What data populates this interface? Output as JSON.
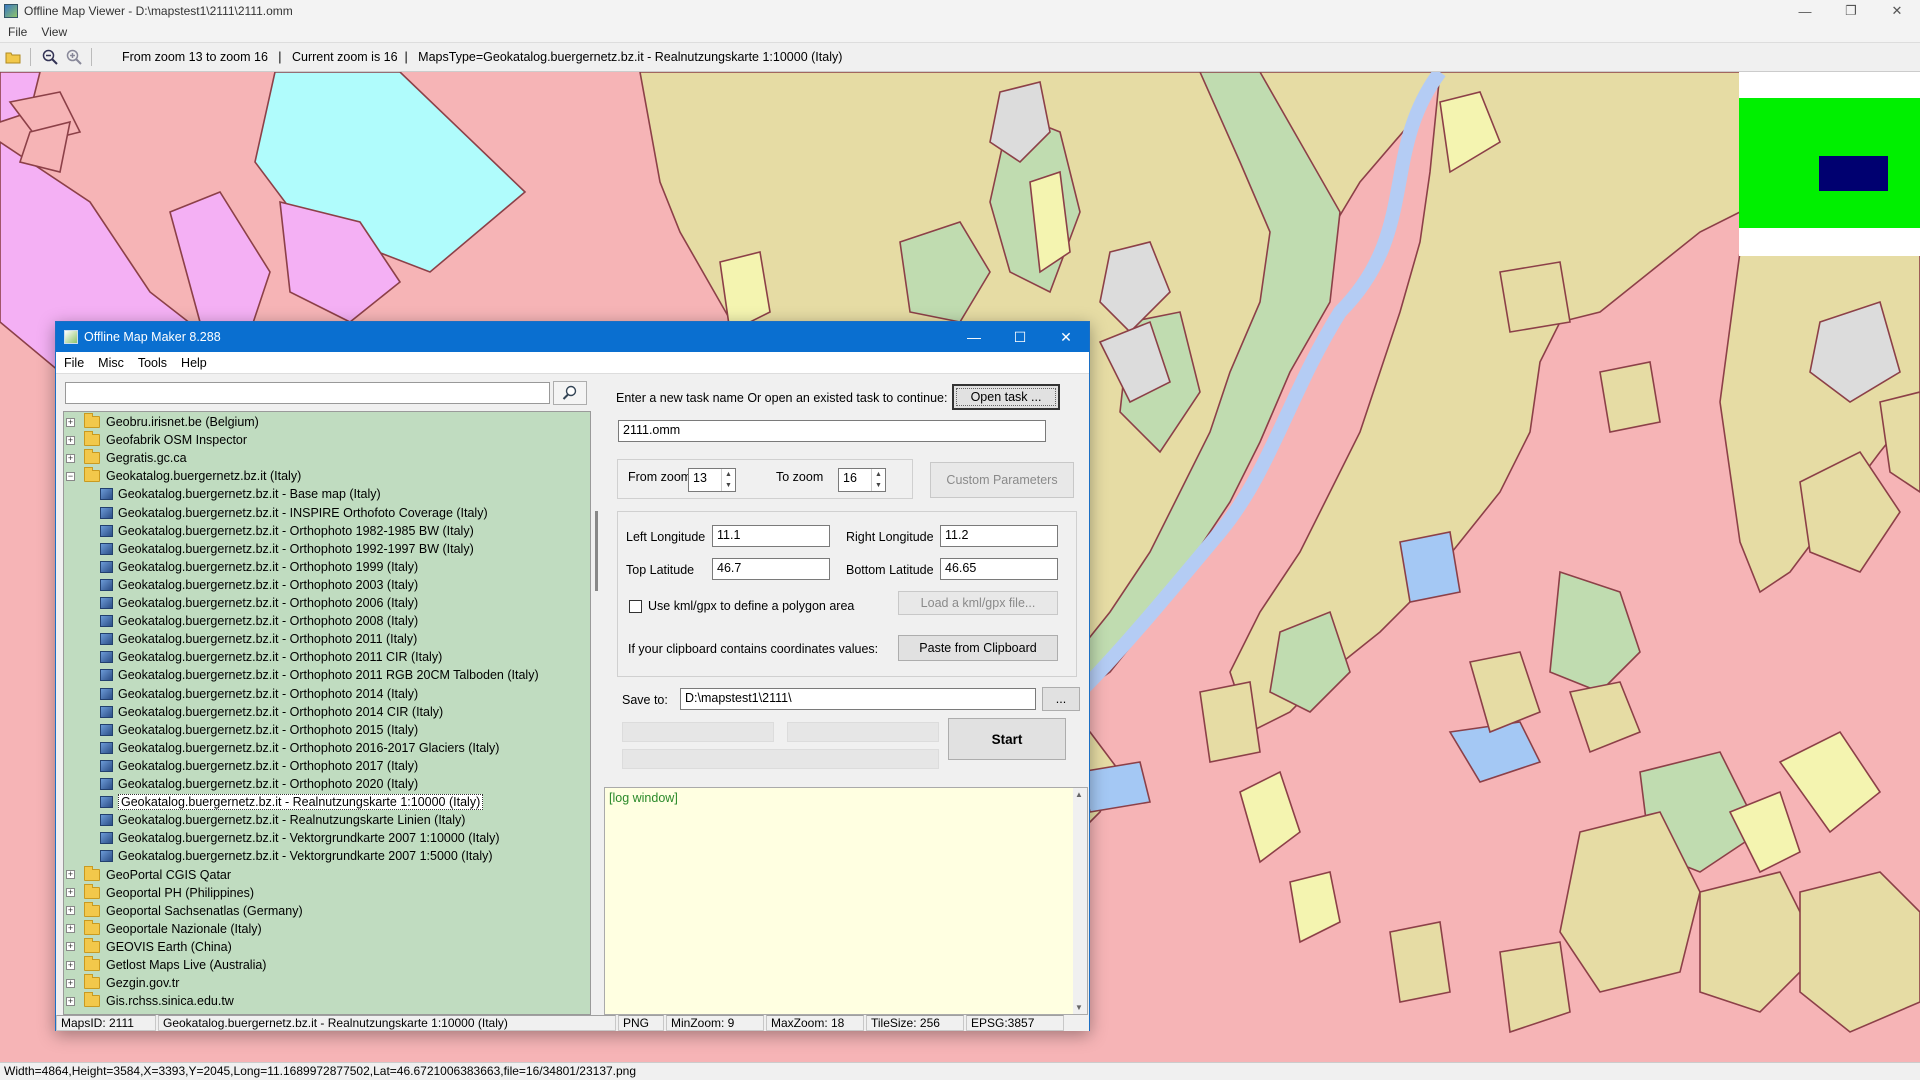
{
  "window": {
    "title": "Offline Map Viewer - D:\\mapstest1\\2111\\2111.omm",
    "menu": [
      "File",
      "View"
    ],
    "controls": {
      "minimize": "—",
      "restore": "❐",
      "close": "✕"
    }
  },
  "toolbar": {
    "open_icon": "folder-open-icon",
    "zoom_out_icon": "zoom-out-icon",
    "zoom_in_icon": "zoom-in-icon",
    "info": "From zoom 13 to zoom 16   |   Current zoom is 16  |   MapsType=Geokatalog.buergernetz.bz.it - Realnutzungskarte 1:10000 (Italy)"
  },
  "statusbar": {
    "text": "Width=4864,Height=3584,X=3393,Y=2045,Long=11.1689972877502,Lat=46.6721006383663,file=16/34801/23137.png"
  },
  "map": {
    "colors": {
      "urban": "#f6b4b6",
      "agri": "#e6dca4",
      "forest": "#c0dcb0",
      "meadow": "#f4f4b0",
      "water": "#a4c8f4",
      "cyan": "#b0fcfc",
      "magenta": "#f4b0f4",
      "grey": "#dcdcdc",
      "outline": "#8c4048",
      "river": "#b4ccf4"
    }
  },
  "minimap": {
    "bg": "#00f000",
    "viewport": "#000070"
  },
  "dialog": {
    "title": "Offline Map Maker 8.288",
    "menu": [
      "File",
      "Misc",
      "Tools",
      "Help"
    ],
    "search_placeholder": "",
    "search_icon": "search-icon",
    "tree": [
      {
        "label": "Geobru.irisnet.be (Belgium)",
        "type": "folder",
        "expanded": false
      },
      {
        "label": "Geofabrik OSM Inspector",
        "type": "folder",
        "expanded": false
      },
      {
        "label": "Gegratis.gc.ca",
        "type": "folder",
        "expanded": false
      },
      {
        "label": "Geokatalog.buergernetz.bz.it (Italy)",
        "type": "folder",
        "expanded": true
      },
      {
        "label": "Geokatalog.buergernetz.bz.it - Base map (Italy)",
        "type": "map"
      },
      {
        "label": "Geokatalog.buergernetz.bz.it - INSPIRE Orthofoto Coverage (Italy)",
        "type": "map"
      },
      {
        "label": "Geokatalog.buergernetz.bz.it - Orthophoto 1982-1985 BW (Italy)",
        "type": "map"
      },
      {
        "label": "Geokatalog.buergernetz.bz.it - Orthophoto 1992-1997 BW (Italy)",
        "type": "map"
      },
      {
        "label": "Geokatalog.buergernetz.bz.it - Orthophoto 1999 (Italy)",
        "type": "map"
      },
      {
        "label": "Geokatalog.buergernetz.bz.it - Orthophoto 2003 (Italy)",
        "type": "map"
      },
      {
        "label": "Geokatalog.buergernetz.bz.it - Orthophoto 2006 (Italy)",
        "type": "map"
      },
      {
        "label": "Geokatalog.buergernetz.bz.it - Orthophoto 2008 (Italy)",
        "type": "map"
      },
      {
        "label": "Geokatalog.buergernetz.bz.it - Orthophoto 2011 (Italy)",
        "type": "map"
      },
      {
        "label": "Geokatalog.buergernetz.bz.it - Orthophoto 2011 CIR (Italy)",
        "type": "map"
      },
      {
        "label": "Geokatalog.buergernetz.bz.it - Orthophoto 2011 RGB 20CM Talboden (Italy)",
        "type": "map"
      },
      {
        "label": "Geokatalog.buergernetz.bz.it - Orthophoto 2014 (Italy)",
        "type": "map"
      },
      {
        "label": "Geokatalog.buergernetz.bz.it - Orthophoto 2014 CIR (Italy)",
        "type": "map"
      },
      {
        "label": "Geokatalog.buergernetz.bz.it - Orthophoto 2015 (Italy)",
        "type": "map"
      },
      {
        "label": "Geokatalog.buergernetz.bz.it - Orthophoto 2016-2017 Glaciers (Italy)",
        "type": "map"
      },
      {
        "label": "Geokatalog.buergernetz.bz.it - Orthophoto 2017 (Italy)",
        "type": "map"
      },
      {
        "label": "Geokatalog.buergernetz.bz.it - Orthophoto 2020 (Italy)",
        "type": "map"
      },
      {
        "label": "Geokatalog.buergernetz.bz.it - Realnutzungskarte 1:10000 (Italy)",
        "type": "map",
        "selected": true
      },
      {
        "label": "Geokatalog.buergernetz.bz.it - Realnutzungskarte Linien (Italy)",
        "type": "map"
      },
      {
        "label": "Geokatalog.buergernetz.bz.it - Vektorgrundkarte 2007 1:10000 (Italy)",
        "type": "map"
      },
      {
        "label": "Geokatalog.buergernetz.bz.it - Vektorgrundkarte 2007 1:5000 (Italy)",
        "type": "map"
      },
      {
        "label": "GeoPortal CGIS Qatar",
        "type": "folder",
        "expanded": false
      },
      {
        "label": "Geoportal PH (Philippines)",
        "type": "folder",
        "expanded": false
      },
      {
        "label": "Geoportal Sachsenatlas (Germany)",
        "type": "folder",
        "expanded": false
      },
      {
        "label": "Geoportale Nazionale (Italy)",
        "type": "folder",
        "expanded": false
      },
      {
        "label": "GEOVIS Earth (China)",
        "type": "folder",
        "expanded": false
      },
      {
        "label": "Getlost Maps Live (Australia)",
        "type": "folder",
        "expanded": false
      },
      {
        "label": "Gezgin.gov.tr",
        "type": "folder",
        "expanded": false
      },
      {
        "label": "Gis.rchss.sinica.edu.tw",
        "type": "folder",
        "expanded": false
      }
    ],
    "task_prompt": "Enter a new task name Or open an existed task to continue:",
    "open_task_label": "Open task ...",
    "task_name": "2111.omm",
    "from_zoom_label": "From zoom",
    "from_zoom": "13",
    "to_zoom_label": "To zoom",
    "to_zoom": "16",
    "custom_params_label": "Custom Parameters",
    "left_lon_label": "Left Longitude",
    "left_lon": "11.1",
    "right_lon_label": "Right Longitude",
    "right_lon": "11.2",
    "top_lat_label": "Top Latitude",
    "top_lat": "46.7",
    "bottom_lat_label": "Bottom Latitude",
    "bottom_lat": "46.65",
    "kml_label": "Use kml/gpx to define a polygon area",
    "kml_checked": false,
    "load_kml_label": "Load a kml/gpx file...",
    "clipboard_label": "If your clipboard contains coordinates values:",
    "paste_label": "Paste from Clipboard",
    "save_to_label": "Save to:",
    "save_to": "D:\\mapstest1\\2111\\",
    "browse_label": "...",
    "start_label": "Start",
    "log_text": "[log window]",
    "status": {
      "maps_id": "MapsID: 2111",
      "maps_name": "Geokatalog.buergernetz.bz.it - Realnutzungskarte 1:10000 (Italy)",
      "format": "PNG",
      "min_zoom": "MinZoom: 9",
      "max_zoom": "MaxZoom: 18",
      "tile_size": "TileSize: 256",
      "epsg": "EPSG:3857"
    }
  }
}
